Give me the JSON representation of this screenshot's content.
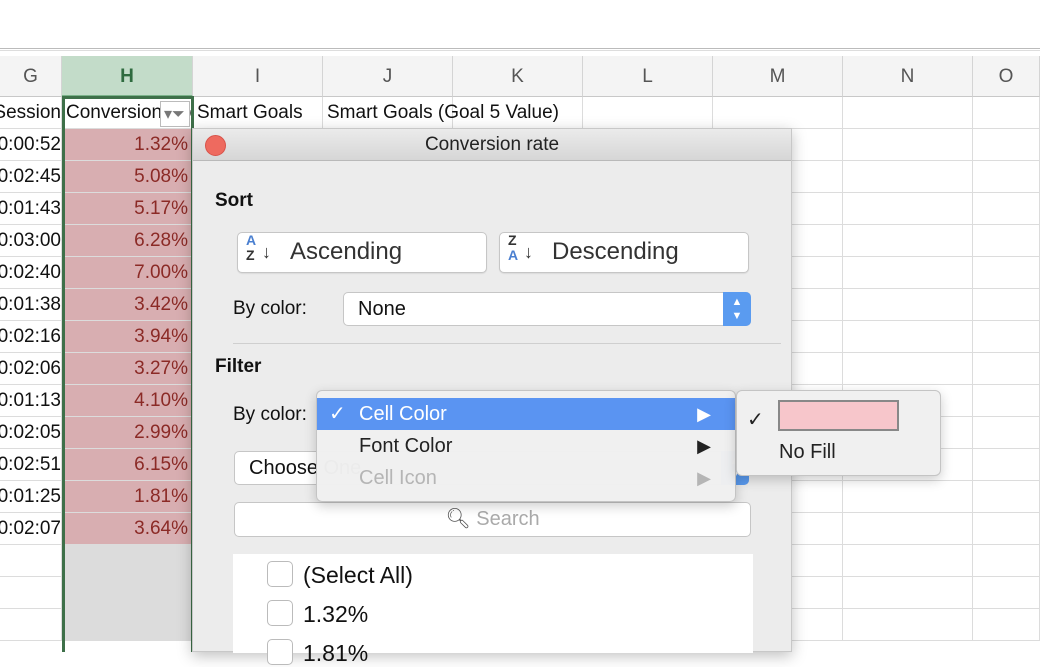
{
  "columns": [
    "G",
    "H",
    "I",
    "J",
    "K",
    "L",
    "M",
    "N",
    "O"
  ],
  "header_row": {
    "g": "Session",
    "h": "Conversion rate",
    "i": "Smart Goals",
    "j": "Smart Goals (Goal 5 Value)"
  },
  "rows": [
    {
      "g": "0:00:52",
      "h": "1.32%"
    },
    {
      "g": "0:02:45",
      "h": "5.08%"
    },
    {
      "g": "0:01:43",
      "h": "5.17%"
    },
    {
      "g": "0:03:00",
      "h": "6.28%"
    },
    {
      "g": "0:02:40",
      "h": "7.00%"
    },
    {
      "g": "0:01:38",
      "h": "3.42%"
    },
    {
      "g": "0:02:16",
      "h": "3.94%"
    },
    {
      "g": "0:02:06",
      "h": "3.27%"
    },
    {
      "g": "0:01:13",
      "h": "4.10%"
    },
    {
      "g": "0:02:05",
      "h": "2.99%"
    },
    {
      "g": "0:02:51",
      "h": "6.15%"
    },
    {
      "g": "0:01:25",
      "h": "1.81%"
    },
    {
      "g": "0:02:07",
      "h": "3.64%"
    }
  ],
  "dialog": {
    "title": "Conversion rate",
    "sort_heading": "Sort",
    "ascending": "Ascending",
    "descending": "Descending",
    "by_color_label": "By color:",
    "sort_by_color": "None",
    "filter_heading": "Filter",
    "filter_by_color_label": "By color:",
    "choose_value": "Choose One",
    "search_placeholder": "Search",
    "list": [
      "(Select All)",
      "1.32%",
      "1.81%"
    ]
  },
  "menu": {
    "items": [
      {
        "label": "Cell Color",
        "checked": true
      },
      {
        "label": "Font Color"
      },
      {
        "label": "Cell Icon",
        "disabled": true
      }
    ]
  },
  "submenu": {
    "swatch_color": "#f7c6cb",
    "no_fill": "No Fill",
    "checked": "swatch"
  },
  "colors": {
    "accent": "#5a94f2",
    "cell_fill": "#d8aeb1",
    "cell_text": "#8b2a26"
  }
}
